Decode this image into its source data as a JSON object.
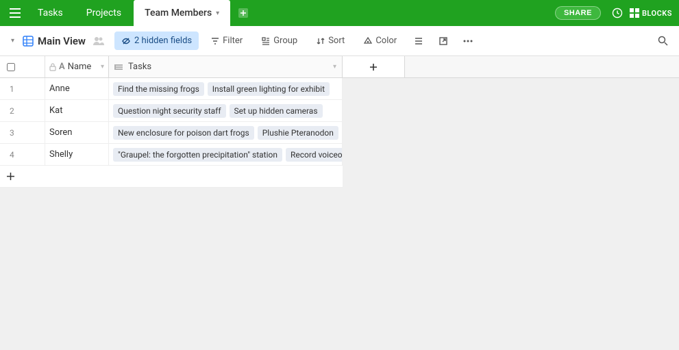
{
  "topbar": {
    "tabs": [
      {
        "label": "Tasks"
      },
      {
        "label": "Projects"
      },
      {
        "label": "Team Members",
        "active": true
      }
    ],
    "share_label": "SHARE",
    "blocks_label": "BLOCKS"
  },
  "toolbar": {
    "view_name": "Main View",
    "hidden_fields": "2 hidden fields",
    "filter": "Filter",
    "group": "Group",
    "sort": "Sort",
    "color": "Color"
  },
  "columns": {
    "name": "Name",
    "tasks": "Tasks"
  },
  "rows": [
    {
      "num": "1",
      "name": "Anne",
      "tasks": [
        "Find the missing frogs",
        "Install green lighting for exhibit"
      ]
    },
    {
      "num": "2",
      "name": "Kat",
      "tasks": [
        "Question night security staff",
        "Set up hidden cameras"
      ]
    },
    {
      "num": "3",
      "name": "Soren",
      "tasks": [
        "New enclosure for poison dart frogs",
        "Plushie Pteranodon"
      ]
    },
    {
      "num": "4",
      "name": "Shelly",
      "tasks": [
        "\"Graupel: the forgotten precipitation\" station",
        "Record voiceover"
      ]
    }
  ]
}
